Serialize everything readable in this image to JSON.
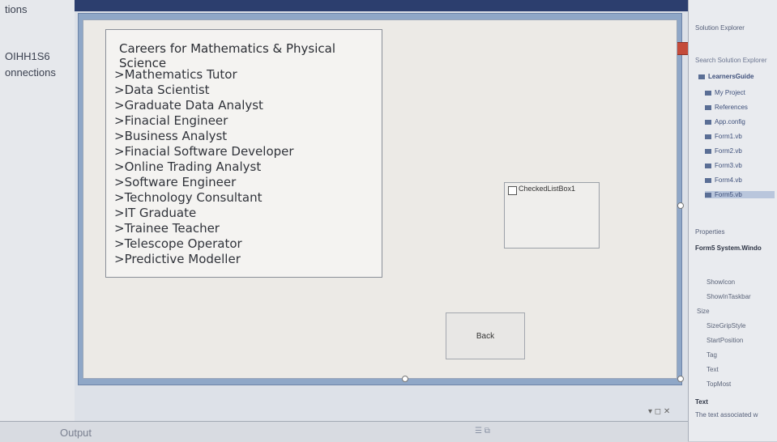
{
  "left_panel": {
    "items": [
      "tions",
      "OIHH1S6",
      "onnections"
    ]
  },
  "form": {
    "careers_title": "Careers for Mathematics & Physical Science",
    "careers": [
      ">Mathematics Tutor",
      ">Data Scientist",
      ">Graduate Data Analyst",
      ">Finacial Engineer",
      ">Business Analyst",
      ">Finacial Software Developer",
      ">Online Trading Analyst",
      ">Software Engineer",
      ">Technology Consultant",
      ">IT Graduate",
      ">Trainee Teacher",
      ">Telescope Operator",
      ">Predictive Modeller"
    ],
    "checked_list_box_label": "CheckedListBox1",
    "back_button": "Back"
  },
  "solution_explorer": {
    "title": "Solution Explorer",
    "search_placeholder": "Search Solution Explorer",
    "project": "LearnersGuide",
    "items": [
      "My Project",
      "References",
      "App.config",
      "Form1.vb",
      "Form2.vb",
      "Form3.vb",
      "Form4.vb",
      "Form5.vb"
    ]
  },
  "properties": {
    "title": "Properties",
    "object": "Form5 System.Windo",
    "rows": [
      "ShowIcon",
      "ShowInTaskbar",
      "Size",
      "SizeGripStyle",
      "StartPosition",
      "Tag",
      "Text",
      "TopMost"
    ],
    "desc_title": "Text",
    "desc": "The text associated w"
  },
  "output": {
    "label": "Output",
    "window_controls": "▾ ◻ ✕"
  }
}
